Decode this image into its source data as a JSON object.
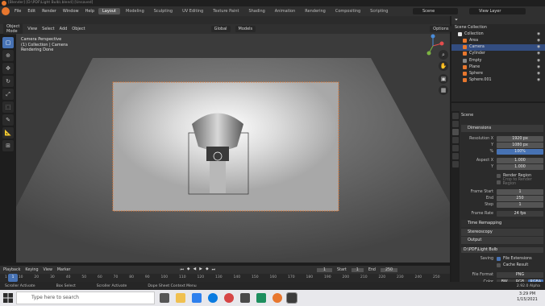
{
  "window": {
    "title": "[Blender] [D:\\PDF\\Light Bulb\\.blend] [Unsaved]"
  },
  "menubar": {
    "menus": [
      "File",
      "Edit",
      "Render",
      "Window",
      "Help"
    ],
    "workspaces": [
      "Layout",
      "Modeling",
      "Sculpting",
      "UV Editing",
      "Texture Paint",
      "Shading",
      "Animation",
      "Rendering",
      "Compositing",
      "Scripting"
    ],
    "scene": "Scene",
    "view_layer": "View Layer"
  },
  "viewport_header": {
    "mode": "Object Mode",
    "view": "View",
    "select": "Select",
    "add": "Add",
    "object": "Object",
    "transform": "Global",
    "snap": "Models",
    "options": "Options"
  },
  "viewport": {
    "info_line1": "Camera Perspective",
    "info_line2": "(1) Collection | Camera",
    "info_line3": "Rendering Done"
  },
  "outliner": {
    "title": "Scene Collection",
    "items": [
      {
        "name": "Collection",
        "color": "#e6e6e6",
        "selected": false
      },
      {
        "name": "Area",
        "color": "#e8772e",
        "selected": false
      },
      {
        "name": "Camera",
        "color": "#e8772e",
        "selected": true
      },
      {
        "name": "Cylinder",
        "color": "#e8772e",
        "selected": false
      },
      {
        "name": "Empty",
        "color": "#888888",
        "selected": false
      },
      {
        "name": "Plane",
        "color": "#e8772e",
        "selected": false
      },
      {
        "name": "Sphere",
        "color": "#e8772e",
        "selected": false
      },
      {
        "name": "Sphere.001",
        "color": "#e8772e",
        "selected": false
      }
    ]
  },
  "properties": {
    "context": "Scene",
    "dimensions": "Dimensions",
    "res_x_label": "Resolution X",
    "res_x": "1920 px",
    "res_y_label": "Y",
    "res_y": "1080 px",
    "pct_label": "%",
    "pct": "100%",
    "aspect_x_label": "Aspect X",
    "aspect_x": "1.000",
    "aspect_y_label": "Y",
    "aspect_y": "1.000",
    "render_region": "Render Region",
    "crop": "Crop to Render Region",
    "frame_start_label": "Frame Start",
    "frame_start": "1",
    "end_label": "End",
    "end": "250",
    "step_label": "Step",
    "step": "1",
    "frame_rate_label": "Frame Rate",
    "frame_rate": "24 fps",
    "time_remap": "Time Remapping",
    "stereo": "Stereoscopy",
    "output": "Output",
    "output_path": "D:\\PDF\\Light Bulb",
    "saving_label": "Saving",
    "file_ext": "File Extensions",
    "cache": "Cache Result",
    "file_format_label": "File Format",
    "file_format": "PNG",
    "color_label": "Color",
    "color_opts": [
      "BW",
      "RGB",
      "RGBA"
    ],
    "version": "2.92.0 Alpha"
  },
  "timeline": {
    "playback": "Playback",
    "keying": "Keying",
    "view": "View",
    "marker": "Marker",
    "current": "1",
    "start_label": "Start",
    "start": "1",
    "end_label": "End",
    "end": "250",
    "ticks": [
      "1",
      "10",
      "20",
      "30",
      "40",
      "50",
      "60",
      "70",
      "80",
      "90",
      "100",
      "110",
      "120",
      "130",
      "140",
      "150",
      "160",
      "170",
      "180",
      "190",
      "200",
      "210",
      "220",
      "230",
      "240",
      "250"
    ]
  },
  "statusbar": {
    "a": "Scroller Activate",
    "b": "Box Select",
    "c": "Scroller Activate",
    "d": "Dope Sheet Context Menu"
  },
  "taskbar": {
    "search": "Type here to search",
    "time": "3:29 PM",
    "date": "1/15/2021"
  }
}
